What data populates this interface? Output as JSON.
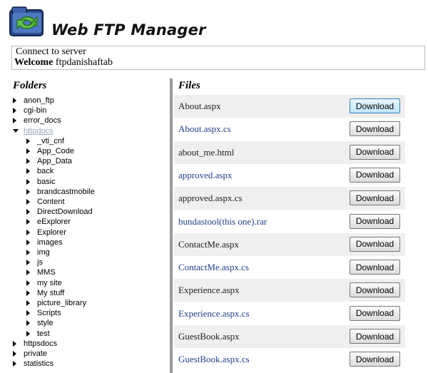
{
  "app": {
    "title": "Web FTP Manager"
  },
  "connection": {
    "title": "Connect to server",
    "welcome_label": "Welcome",
    "username": "ftpdanishaftab"
  },
  "folders": {
    "heading": "Folders",
    "items": [
      {
        "label": "anon_ftp",
        "level": 0,
        "expanded": false
      },
      {
        "label": "cgi-bin",
        "level": 0,
        "expanded": false
      },
      {
        "label": "error_docs",
        "level": 0,
        "expanded": false
      },
      {
        "label": "httpdocs",
        "level": 0,
        "expanded": true,
        "selected": true
      },
      {
        "label": "_vti_cnf",
        "level": 1,
        "expanded": false
      },
      {
        "label": "App_Code",
        "level": 1,
        "expanded": false
      },
      {
        "label": "App_Data",
        "level": 1,
        "expanded": false
      },
      {
        "label": "back",
        "level": 1,
        "expanded": false
      },
      {
        "label": "basic",
        "level": 1,
        "expanded": false
      },
      {
        "label": "brandcastmobile",
        "level": 1,
        "expanded": false
      },
      {
        "label": "Content",
        "level": 1,
        "expanded": false
      },
      {
        "label": "DirectDownload",
        "level": 1,
        "expanded": false
      },
      {
        "label": "eExplorer",
        "level": 1,
        "expanded": false
      },
      {
        "label": "Explorer",
        "level": 1,
        "expanded": false
      },
      {
        "label": "images",
        "level": 1,
        "expanded": false
      },
      {
        "label": "img",
        "level": 1,
        "expanded": false
      },
      {
        "label": "js",
        "level": 1,
        "expanded": false
      },
      {
        "label": "MMS",
        "level": 1,
        "expanded": false
      },
      {
        "label": "my site",
        "level": 1,
        "expanded": false
      },
      {
        "label": "My stuff",
        "level": 1,
        "expanded": false
      },
      {
        "label": "picture_library",
        "level": 1,
        "expanded": false
      },
      {
        "label": "Scripts",
        "level": 1,
        "expanded": false
      },
      {
        "label": "style",
        "level": 1,
        "expanded": false
      },
      {
        "label": "test",
        "level": 1,
        "expanded": false
      },
      {
        "label": "httpsdocs",
        "level": 0,
        "expanded": false
      },
      {
        "label": "private",
        "level": 0,
        "expanded": false
      },
      {
        "label": "statistics",
        "level": 0,
        "expanded": false
      }
    ]
  },
  "files": {
    "heading": "Files",
    "download_label": "Download",
    "items": [
      {
        "name": "About.aspx",
        "style": "plain",
        "focused": true
      },
      {
        "name": "About.aspx.cs",
        "style": "link",
        "focused": false
      },
      {
        "name": "about_me.html",
        "style": "plain",
        "focused": false
      },
      {
        "name": "approved.aspx",
        "style": "link",
        "focused": false
      },
      {
        "name": "approved.aspx.cs",
        "style": "plain",
        "focused": false
      },
      {
        "name": "bundastool(this one).rar",
        "style": "link",
        "focused": false
      },
      {
        "name": "ContactMe.aspx",
        "style": "plain",
        "focused": false
      },
      {
        "name": "ContactMe.aspx.cs",
        "style": "link",
        "focused": false
      },
      {
        "name": "Experience.aspx",
        "style": "plain",
        "focused": false
      },
      {
        "name": "Experience.aspx.cs",
        "style": "link",
        "focused": false
      },
      {
        "name": "GuestBook.aspx",
        "style": "plain",
        "focused": false
      },
      {
        "name": "GuestBook.aspx.cs",
        "style": "link",
        "focused": false
      }
    ]
  },
  "colors": {
    "link": "#1f3f8a",
    "alt_row": "#efefef",
    "selected_folder": "#9aa7b8",
    "separator": "#999999"
  }
}
